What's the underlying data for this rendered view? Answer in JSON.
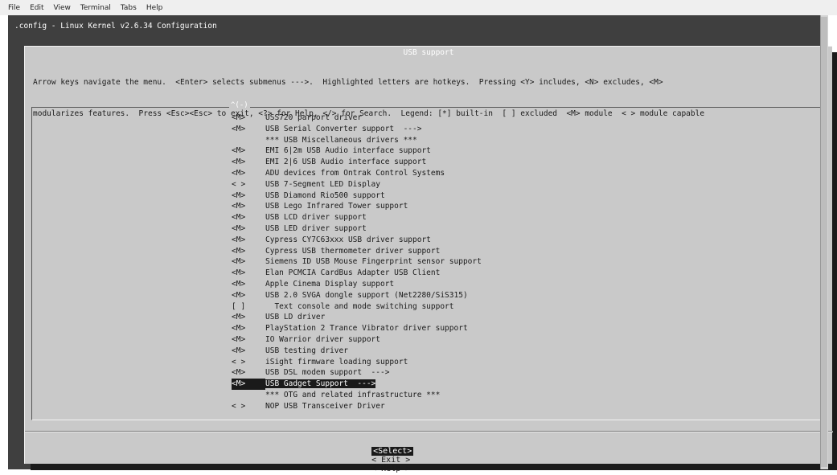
{
  "menubar": {
    "items": [
      "File",
      "Edit",
      "View",
      "Terminal",
      "Tabs",
      "Help"
    ]
  },
  "terminal": {
    "title_line": ".config - Linux Kernel v2.6.34 Configuration"
  },
  "dialog": {
    "title": "USB support",
    "help_line1": "Arrow keys navigate the menu.  <Enter> selects submenus --->.  Highlighted letters are hotkeys.  Pressing <Y> includes, <N> excludes, <M>",
    "help_line2": "modularizes features.  Press <Esc><Esc> to exit, <?> for Help, </> for Search.  Legend: [*] built-in  [ ] excluded  <M> module  < > module capable",
    "scroll_indicator": "^(-)",
    "items": [
      {
        "mark": "<M>",
        "label": "USS720 parport driver"
      },
      {
        "mark": "<M>",
        "label": "USB Serial Converter support  --->"
      },
      {
        "mark": "",
        "label": "*** USB Miscellaneous drivers ***"
      },
      {
        "mark": "<M>",
        "label": "EMI 6|2m USB Audio interface support"
      },
      {
        "mark": "<M>",
        "label": "EMI 2|6 USB Audio interface support"
      },
      {
        "mark": "<M>",
        "label": "ADU devices from Ontrak Control Systems"
      },
      {
        "mark": "< >",
        "label": "USB 7-Segment LED Display"
      },
      {
        "mark": "<M>",
        "label": "USB Diamond Rio500 support"
      },
      {
        "mark": "<M>",
        "label": "USB Lego Infrared Tower support"
      },
      {
        "mark": "<M>",
        "label": "USB LCD driver support"
      },
      {
        "mark": "<M>",
        "label": "USB LED driver support"
      },
      {
        "mark": "<M>",
        "label": "Cypress CY7C63xxx USB driver support"
      },
      {
        "mark": "<M>",
        "label": "Cypress USB thermometer driver support"
      },
      {
        "mark": "<M>",
        "label": "Siemens ID USB Mouse Fingerprint sensor support"
      },
      {
        "mark": "<M>",
        "label": "Elan PCMCIA CardBus Adapter USB Client"
      },
      {
        "mark": "<M>",
        "label": "Apple Cinema Display support"
      },
      {
        "mark": "<M>",
        "label": "USB 2.0 SVGA dongle support (Net2280/SiS315)"
      },
      {
        "mark": "[ ]",
        "label": "  Text console and mode switching support"
      },
      {
        "mark": "<M>",
        "label": "USB LD driver"
      },
      {
        "mark": "<M>",
        "label": "PlayStation 2 Trance Vibrator driver support"
      },
      {
        "mark": "<M>",
        "label": "IO Warrior driver support"
      },
      {
        "mark": "<M>",
        "label": "USB testing driver"
      },
      {
        "mark": "< >",
        "label": "iSight firmware loading support"
      },
      {
        "mark": "<M>",
        "label": "USB DSL modem support  --->"
      },
      {
        "mark": "<M>",
        "label": "USB Gadget Support  --->",
        "selected": true
      },
      {
        "mark": "",
        "label": "*** OTG and related infrastructure ***"
      },
      {
        "mark": "< >",
        "label": "NOP USB Transceiver Driver"
      }
    ],
    "buttons": {
      "select": "<Select>",
      "exit": "< Exit >",
      "help": "< Help >"
    }
  },
  "colors": {
    "terminal_bg": "#3f3f3f",
    "dialog_bg": "#c9c9c9",
    "highlight": "#1a1a1a"
  }
}
